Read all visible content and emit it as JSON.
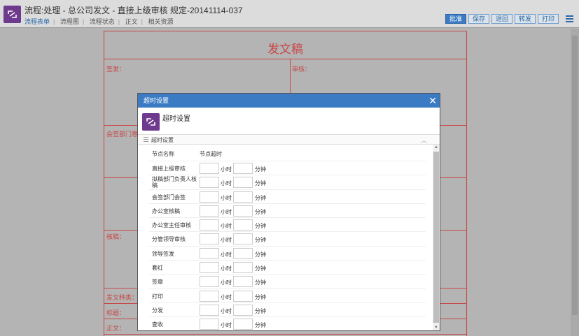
{
  "header": {
    "title": "流程:处理 - 总公司发文 - 直接上级审核 规定-20141114-037",
    "tabs": [
      "流程表单",
      "流程图",
      "流程状态",
      "正文",
      "相关资源"
    ],
    "buttons": [
      "批准",
      "保存",
      "退回",
      "转发",
      "打印"
    ]
  },
  "document": {
    "title": "发文稿",
    "labels": {
      "sign": "签发：",
      "review": "审核：",
      "countersign": "会签部门意见：",
      "draft": "核稿：",
      "category": "发文种类：",
      "subject": "标题：",
      "body": "正文："
    }
  },
  "modal": {
    "header_title": "超时设置",
    "title": "超时设置",
    "section_title": "超时设置",
    "columns": {
      "name": "节点名称",
      "timeout": "节点超时"
    },
    "units": {
      "hour": "小时",
      "minute": "分钟"
    },
    "rows": [
      {
        "name": "直接上级审核"
      },
      {
        "name": "拟稿部门负责人核稿"
      },
      {
        "name": "会签部门会签"
      },
      {
        "name": "办公室核稿"
      },
      {
        "name": "办公室主任审核"
      },
      {
        "name": "分管领导审核"
      },
      {
        "name": "领导签发"
      },
      {
        "name": "套红"
      },
      {
        "name": "签章"
      },
      {
        "name": "打印"
      },
      {
        "name": "分发"
      },
      {
        "name": "查收"
      }
    ]
  }
}
